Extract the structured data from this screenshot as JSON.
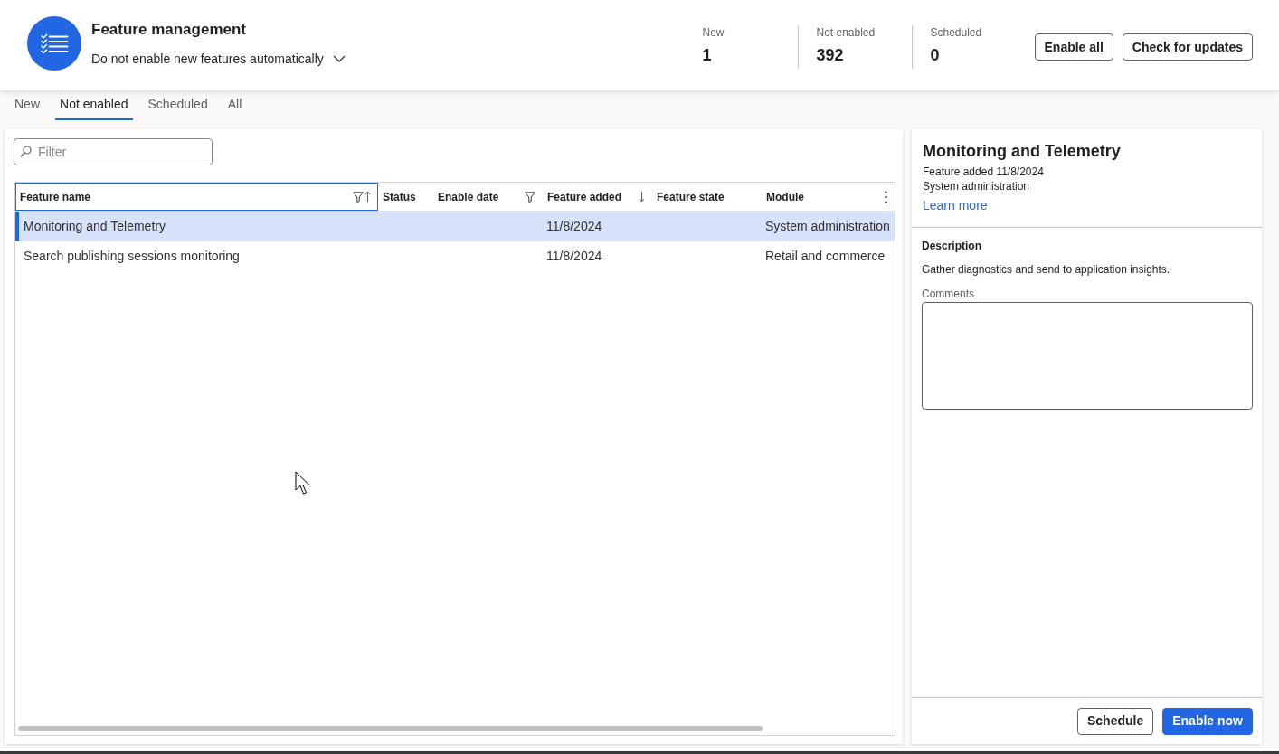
{
  "header": {
    "app_title": "Feature management",
    "auto_enable_setting": "Do not enable new features automatically",
    "stats": [
      {
        "label": "New",
        "value": "1"
      },
      {
        "label": "Not enabled",
        "value": "392"
      },
      {
        "label": "Scheduled",
        "value": "0"
      }
    ],
    "buttons": [
      {
        "label": "Enable all"
      },
      {
        "label": "Check for updates"
      }
    ]
  },
  "tabs": [
    {
      "label": "New",
      "selected": false
    },
    {
      "label": "Not enabled",
      "selected": true
    },
    {
      "label": "Scheduled",
      "selected": false
    },
    {
      "label": "All",
      "selected": false
    }
  ],
  "filter": {
    "placeholder": "Filter"
  },
  "table": {
    "columns": [
      {
        "label": "Feature name",
        "focused": true,
        "filtered": true,
        "sorted_ascending": true,
        "sorted_descending": false
      },
      {
        "label": "Status",
        "focused": false,
        "filtered": false,
        "sorted_ascending": false,
        "sorted_descending": false
      },
      {
        "label": "Enable date",
        "focused": false,
        "filtered": true,
        "sorted_ascending": false,
        "sorted_descending": false
      },
      {
        "label": "Feature added",
        "focused": false,
        "filtered": false,
        "sorted_ascending": false,
        "sorted_descending": true
      },
      {
        "label": "Feature state",
        "focused": false,
        "filtered": false,
        "sorted_ascending": false,
        "sorted_descending": false
      },
      {
        "label": "Module",
        "focused": false,
        "filtered": false,
        "sorted_ascending": false,
        "sorted_descending": false
      }
    ],
    "rows": [
      {
        "feature_name": "Monitoring and Telemetry",
        "feature_added": "11/8/2024",
        "module": "System administration",
        "selected": true
      },
      {
        "feature_name": "Search publishing sessions monitoring",
        "feature_added": "11/8/2024",
        "module": "Retail and commerce",
        "selected": false
      }
    ]
  },
  "details": {
    "title": "Monitoring and Telemetry",
    "feature_added": "Feature added 11/8/2024",
    "module": "System administration",
    "link": "Learn more",
    "description_label": "Description",
    "description": "Gather diagnostics and send to application insights.",
    "comments": {
      "label": "Comments"
    },
    "buttons": [
      {
        "label": "Schedule",
        "kind": "secondary"
      },
      {
        "label": "Enable now",
        "kind": "primary"
      }
    ]
  }
}
